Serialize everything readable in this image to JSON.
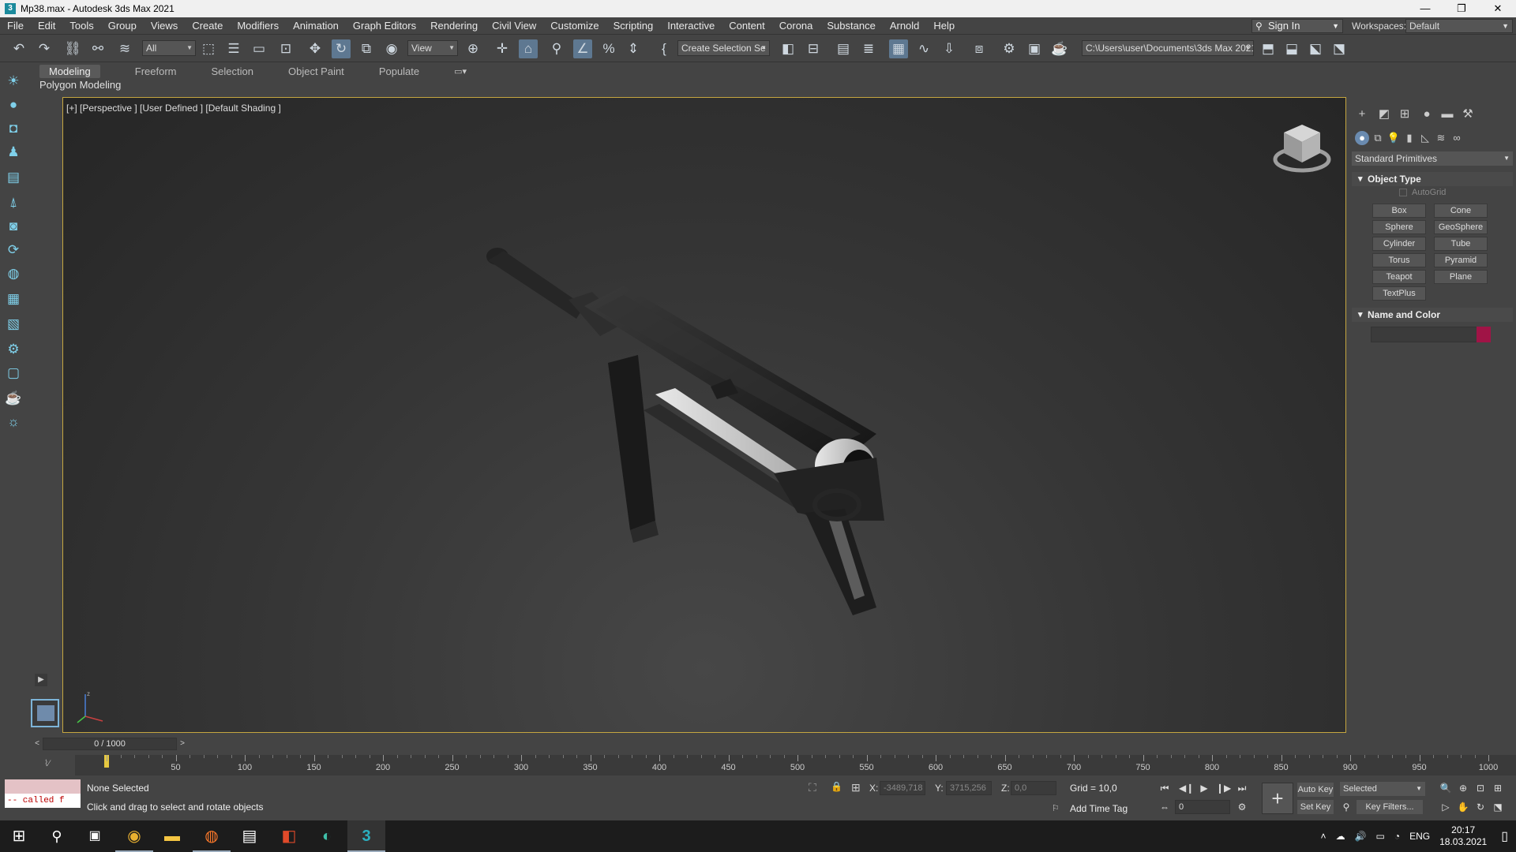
{
  "window": {
    "title": "Mp38.max - Autodesk 3ds Max 2021",
    "app_icon": "3",
    "controls": [
      "—",
      "❐",
      "✕"
    ]
  },
  "menu": {
    "items": [
      "File",
      "Edit",
      "Tools",
      "Group",
      "Views",
      "Create",
      "Modifiers",
      "Animation",
      "Graph Editors",
      "Rendering",
      "Civil View",
      "Customize",
      "Scripting",
      "Interactive",
      "Content",
      "Corona",
      "Substance",
      "Arnold",
      "Help"
    ],
    "sign_in": "Sign In",
    "workspaces_label": "Workspaces:",
    "workspace_value": "Default"
  },
  "toolbar": {
    "selection_filter": "All",
    "ref_coord": "View",
    "named_selection": "Create Selection Se",
    "project_path": "C:\\Users\\user\\Documents\\3ds Max 2021"
  },
  "ribbon": {
    "tabs": [
      "Modeling",
      "Freeform",
      "Selection",
      "Object Paint",
      "Populate"
    ],
    "active_tab": "Modeling",
    "subpanel": "Polygon Modeling"
  },
  "viewport": {
    "label": "[+] [Perspective ] [User Defined ] [Default Shading ]",
    "accent_color": "#c5a640"
  },
  "command_panel": {
    "category": "Standard Primitives",
    "object_type_title": "Object Type",
    "autogrid": "AutoGrid",
    "primitives": [
      "Box",
      "Cone",
      "Sphere",
      "GeoSphere",
      "Cylinder",
      "Tube",
      "Torus",
      "Pyramid",
      "Teapot",
      "Plane",
      "TextPlus"
    ],
    "name_color_title": "Name and Color",
    "object_color": "#a01446"
  },
  "timeline": {
    "slider_text": "0 / 1000",
    "prev": "<",
    "next": ">",
    "labels": [
      "0",
      "50",
      "100",
      "150",
      "200",
      "250",
      "300",
      "350",
      "400",
      "450",
      "500",
      "550",
      "600",
      "650",
      "700",
      "750",
      "800",
      "850",
      "900",
      "950",
      "1000"
    ]
  },
  "status": {
    "maxscript_output": "-- called f",
    "selection": "None Selected",
    "prompt": "Click and drag to select and rotate objects",
    "x_label": "X:",
    "x_value": "-3489,718",
    "y_label": "Y:",
    "y_value": "3715,256",
    "z_label": "Z:",
    "z_value": "0,0",
    "grid": "Grid = 10,0",
    "add_time_tag": "Add Time Tag",
    "auto_key": "Auto Key",
    "set_key": "Set Key",
    "selected": "Selected",
    "key_filters": "Key Filters...",
    "frame": "0"
  },
  "taskbar": {
    "lang": "ENG",
    "time": "20:17",
    "date": "18.03.2021"
  }
}
